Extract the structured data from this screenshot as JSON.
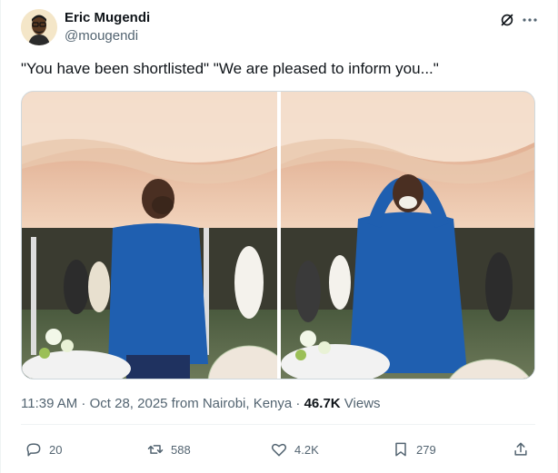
{
  "author": {
    "name": "Eric Mugendi",
    "handle": "@mougendi"
  },
  "tweet": {
    "text": "\"You have been shortlisted\" \"We are pleased to inform you...\""
  },
  "meta": {
    "time": "11:39 AM",
    "separator1": " · ",
    "date": "Oct 28, 2025",
    "location": " from Nairobi, Kenya",
    "separator2": " · ",
    "views_count": "46.7K",
    "views_label": " Views"
  },
  "actions": {
    "replies": "20",
    "reposts": "588",
    "likes": "4.2K",
    "bookmarks": "279"
  },
  "icons": {
    "header": [
      "grok-icon",
      "more-icon"
    ],
    "actions": [
      "reply-icon",
      "repost-icon",
      "like-icon",
      "bookmark-icon",
      "share-icon"
    ]
  },
  "colors": {
    "text": "#0f1419",
    "secondary": "#536471",
    "border": "#cfd9de"
  }
}
